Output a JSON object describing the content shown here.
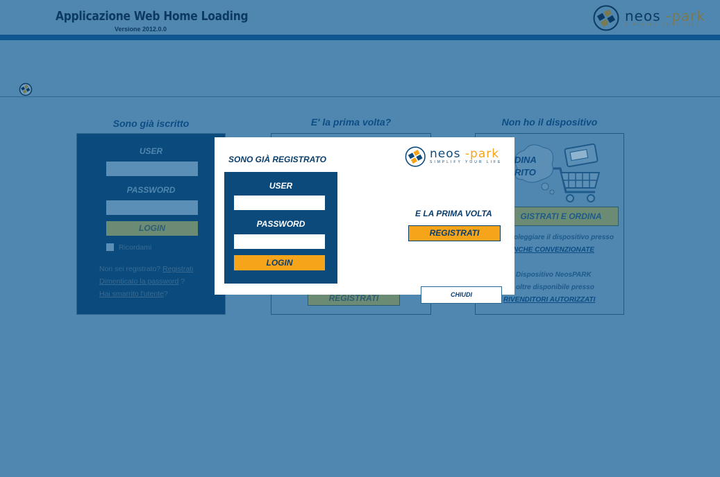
{
  "header": {
    "app_title": "Applicazione Web Home Loading",
    "version": "Versione 2012.0.0",
    "logo_word_left": "neos",
    "logo_word_right": "park",
    "logo_tagline": "SIMPLIFY YOUR LIFE"
  },
  "columns": {
    "login": {
      "title": "Sono già iscritto",
      "user_label": "USER",
      "password_label": "PASSWORD",
      "login_button": "LOGIN",
      "remember_label": "Ricordami",
      "not_registered_text": "Non sei registrato?",
      "register_link": "Registrati",
      "forgot_password_link": "Dimenticato la password",
      "forgot_suffix": "?",
      "lost_user_link": "Hai smarrito l'utente",
      "lost_suffix": "?"
    },
    "first_time": {
      "title": "E' la prima volta?",
      "register_button": "REGISTRATI"
    },
    "no_device": {
      "title": "Non ho il dispositivo",
      "order_line1": "DINA",
      "order_line2": "RITO",
      "register_order_button": "GISTRATI E ORDINA",
      "rent_text": "oleggiare il dispositivo presso",
      "partner_banks_link": "NCHE CONVENZIONATE",
      "device_text": "Dispositivo NeosPARK",
      "available_text": "oltre disponibile presso",
      "resellers_link": "RIVENDITORI AUTORIZZATI"
    }
  },
  "modal": {
    "title": "SONO GIÀ REGISTRATO",
    "user_label": "USER",
    "password_label": "PASSWORD",
    "login_button": "LOGIN",
    "first_time_label": "E LA PRIMA VOLTA",
    "register_button": "REGISTRATI",
    "close_button": "CHIUDI",
    "logo_word_left": "neos",
    "logo_word_right": "park",
    "logo_tagline": "SIMPLIFY YOUR LIFE"
  },
  "colors": {
    "background": "#4f87b0",
    "header_bar": "#0f5690",
    "panel_dark": "#0b4a7b",
    "accent_orange": "#f6a41a"
  }
}
